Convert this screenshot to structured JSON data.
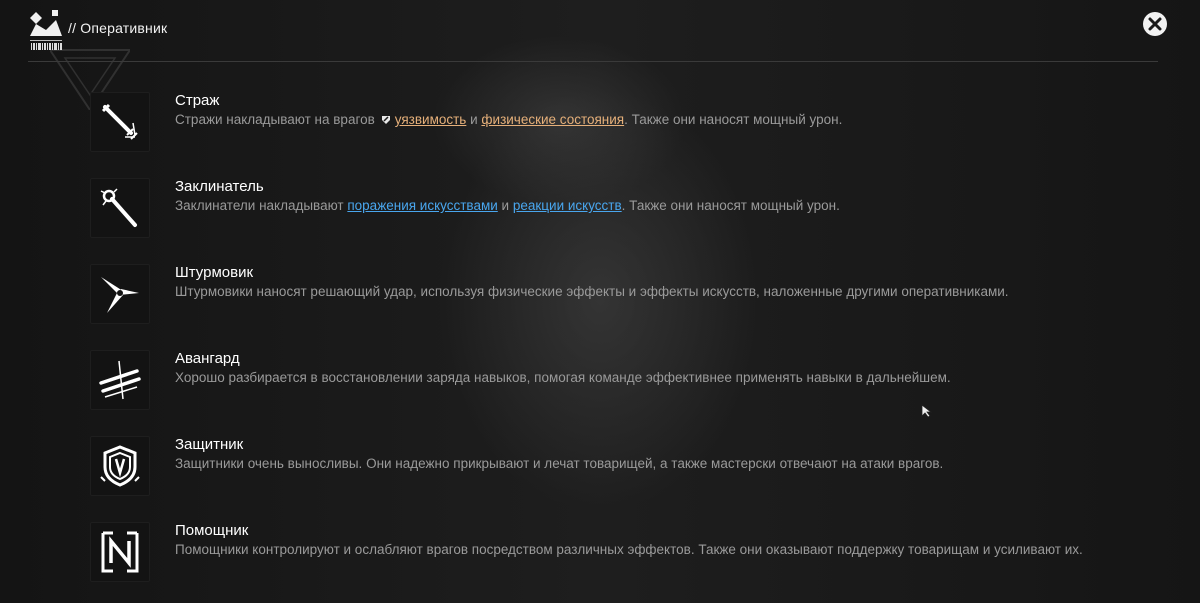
{
  "header": {
    "title": "// Оперативник",
    "logo_icon": "operator-logo-icon",
    "close_icon": "close-icon"
  },
  "classes": [
    {
      "name": "Страж",
      "icon": "sword-icon",
      "desc_pre": "Стражи накладывают на врагов",
      "tag_icon": "shield-mark-icon",
      "link1": "уязвимость",
      "link_joiner": "и",
      "link2": "физические состояния",
      "desc_post": ". Также они наносят мощный урон.",
      "link_color": "#e6b07a"
    },
    {
      "name": "Заклинатель",
      "icon": "staff-icon",
      "desc_pre": "Заклинатели накладывают",
      "link1": "поражения искусствами",
      "link_joiner": "и",
      "link2": "реакции искусств",
      "desc_post": ". Также они наносят мощный урон.",
      "link_color": "#49a6ee"
    },
    {
      "name": "Штурмовик",
      "icon": "star-blade-icon",
      "desc": "Штурмовики наносят решающий удар, используя физические эффекты и эффекты искусств, наложенные другими оперативниками."
    },
    {
      "name": "Авангард",
      "icon": "slash-icon",
      "desc": "Хорошо разбирается в восстановлении заряда навыков, помогая команде эффективнее применять навыки в дальнейшем."
    },
    {
      "name": "Защитник",
      "icon": "shield-icon",
      "desc": "Защитники очень выносливы. Они надежно прикрывают и лечат товарищей, а также мастерски отвечают на атаки врагов."
    },
    {
      "name": "Помощник",
      "icon": "support-icon",
      "desc": "Помощники контролируют и ослабляют врагов посредством различных эффектов. Также они оказывают поддержку товарищам и усиливают их."
    }
  ]
}
